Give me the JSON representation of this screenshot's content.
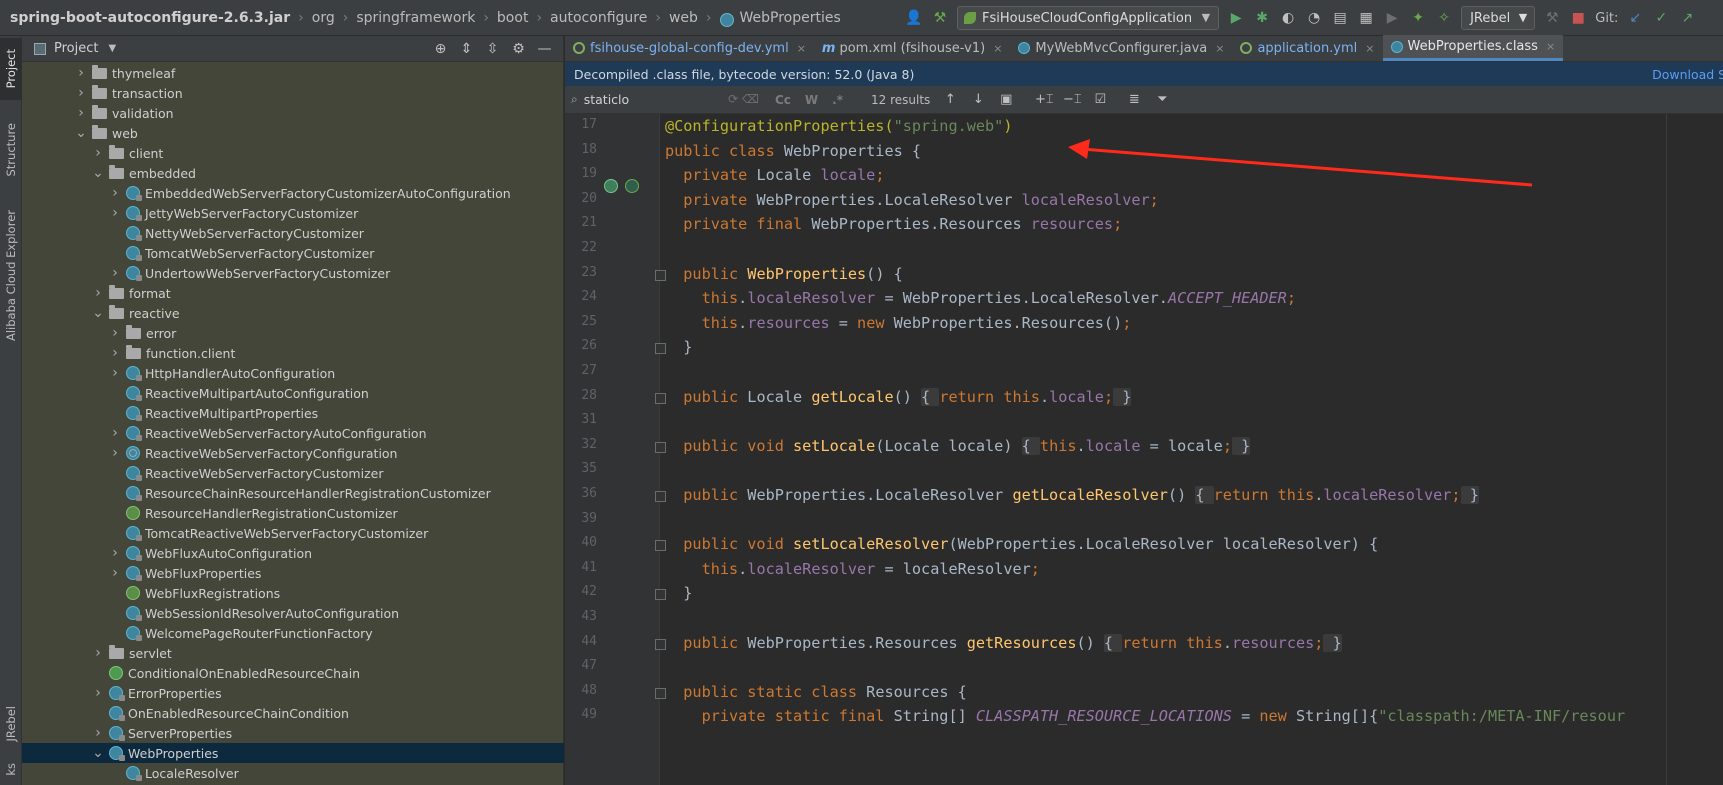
{
  "breadcrumb": {
    "items": [
      "spring-boot-autoconfigure-2.6.3.jar",
      "org",
      "springframework",
      "boot",
      "autoconfigure",
      "web"
    ],
    "current": "WebProperties"
  },
  "toolbar": {
    "run_config": "FsiHouseCloudConfigApplication",
    "jrebel": "JRebel",
    "git_label": "Git:"
  },
  "tool_strip": {
    "project": "Project",
    "structure": "Structure",
    "alibaba": "Alibaba Cloud Explorer",
    "jrebel": "JRebel",
    "bottom": "ks"
  },
  "project_panel": {
    "title": "Project",
    "tree": [
      {
        "label": "thymeleaf",
        "type": "folder",
        "level": 1,
        "arrow": "right"
      },
      {
        "label": "transaction",
        "type": "folder",
        "level": 1,
        "arrow": "right"
      },
      {
        "label": "validation",
        "type": "folder",
        "level": 1,
        "arrow": "right"
      },
      {
        "label": "web",
        "type": "folder",
        "level": 1,
        "arrow": "down"
      },
      {
        "label": "client",
        "type": "folder",
        "level": 2,
        "arrow": "right"
      },
      {
        "label": "embedded",
        "type": "folder",
        "level": 2,
        "arrow": "down"
      },
      {
        "label": "EmbeddedWebServerFactoryCustomizerAutoConfiguration",
        "type": "class",
        "level": 3,
        "arrow": "right"
      },
      {
        "label": "JettyWebServerFactoryCustomizer",
        "type": "class",
        "level": 3,
        "arrow": "right"
      },
      {
        "label": "NettyWebServerFactoryCustomizer",
        "type": "class",
        "level": 3,
        "arrow": "none"
      },
      {
        "label": "TomcatWebServerFactoryCustomizer",
        "type": "class",
        "level": 3,
        "arrow": "none"
      },
      {
        "label": "UndertowWebServerFactoryCustomizer",
        "type": "class",
        "level": 3,
        "arrow": "right"
      },
      {
        "label": "format",
        "type": "folder",
        "level": 2,
        "arrow": "right"
      },
      {
        "label": "reactive",
        "type": "folder",
        "level": 2,
        "arrow": "down"
      },
      {
        "label": "error",
        "type": "folder",
        "level": 3,
        "arrow": "right"
      },
      {
        "label": "function.client",
        "type": "folder",
        "level": 3,
        "arrow": "right"
      },
      {
        "label": "HttpHandlerAutoConfiguration",
        "type": "class",
        "level": 3,
        "arrow": "right"
      },
      {
        "label": "ReactiveMultipartAutoConfiguration",
        "type": "class",
        "level": 3,
        "arrow": "none"
      },
      {
        "label": "ReactiveMultipartProperties",
        "type": "class",
        "level": 3,
        "arrow": "none"
      },
      {
        "label": "ReactiveWebServerFactoryAutoConfiguration",
        "type": "class",
        "level": 3,
        "arrow": "right"
      },
      {
        "label": "ReactiveWebServerFactoryConfiguration",
        "type": "cfg",
        "level": 3,
        "arrow": "right"
      },
      {
        "label": "ReactiveWebServerFactoryCustomizer",
        "type": "class",
        "level": 3,
        "arrow": "none"
      },
      {
        "label": "ResourceChainResourceHandlerRegistrationCustomizer",
        "type": "class",
        "level": 3,
        "arrow": "none"
      },
      {
        "label": "ResourceHandlerRegistrationCustomizer",
        "type": "iface",
        "level": 3,
        "arrow": "none"
      },
      {
        "label": "TomcatReactiveWebServerFactoryCustomizer",
        "type": "class",
        "level": 3,
        "arrow": "none"
      },
      {
        "label": "WebFluxAutoConfiguration",
        "type": "class",
        "level": 3,
        "arrow": "right"
      },
      {
        "label": "WebFluxProperties",
        "type": "class",
        "level": 3,
        "arrow": "right"
      },
      {
        "label": "WebFluxRegistrations",
        "type": "iface",
        "level": 3,
        "arrow": "none"
      },
      {
        "label": "WebSessionIdResolverAutoConfiguration",
        "type": "class",
        "level": 3,
        "arrow": "none"
      },
      {
        "label": "WelcomePageRouterFunctionFactory",
        "type": "class",
        "level": 3,
        "arrow": "none"
      },
      {
        "label": "servlet",
        "type": "folder",
        "level": 2,
        "arrow": "right"
      },
      {
        "label": "ConditionalOnEnabledResourceChain",
        "type": "anno",
        "level": 2,
        "arrow": "none"
      },
      {
        "label": "ErrorProperties",
        "type": "class",
        "level": 2,
        "arrow": "right"
      },
      {
        "label": "OnEnabledResourceChainCondition",
        "type": "class",
        "level": 2,
        "arrow": "none"
      },
      {
        "label": "ServerProperties",
        "type": "class",
        "level": 2,
        "arrow": "right"
      },
      {
        "label": "WebProperties",
        "type": "class",
        "level": 2,
        "arrow": "down",
        "selected": true
      },
      {
        "label": "LocaleResolver",
        "type": "class",
        "level": 3,
        "arrow": "none"
      }
    ]
  },
  "editor": {
    "tabs": [
      {
        "label": "fsihouse-global-config-dev.yml",
        "icon": "yml",
        "active": false
      },
      {
        "label": "pom.xml (fsihouse-v1)",
        "icon": "mvn",
        "active": false
      },
      {
        "label": "MyWebMvcConfigurer.java",
        "icon": "java",
        "active": false
      },
      {
        "label": "application.yml",
        "icon": "yml",
        "active": false
      },
      {
        "label": "WebProperties.class",
        "icon": "java",
        "active": true
      }
    ],
    "info_text": "Decompiled .class file, bytecode version: 52.0 (Java 8)",
    "info_link": "Download Sc",
    "find": {
      "query": "staticlo",
      "results": "12 results",
      "opt_case": "Cc",
      "opt_word": "W",
      "opt_regex": ".*"
    },
    "line_numbers": [
      "17",
      "18",
      "19",
      "20",
      "21",
      "22",
      "23",
      "24",
      "25",
      "26",
      "27",
      "28",
      "31",
      "32",
      "35",
      "36",
      "39",
      "40",
      "41",
      "42",
      "43",
      "44",
      "47",
      "48",
      "49"
    ],
    "code_lines": [
      [
        {
          "t": "@ConfigurationProperties(",
          "c": "ann"
        },
        {
          "t": "\"spring.web\"",
          "c": "str"
        },
        {
          "t": ")",
          "c": "ann"
        }
      ],
      [
        {
          "t": "public class ",
          "c": "kw"
        },
        {
          "t": "WebProperties {",
          "c": ""
        }
      ],
      [
        {
          "t": "  private ",
          "c": "kw"
        },
        {
          "t": "Locale ",
          "c": ""
        },
        {
          "t": "locale",
          "c": "fld"
        },
        {
          "t": ";",
          "c": "kw"
        }
      ],
      [
        {
          "t": "  private ",
          "c": "kw"
        },
        {
          "t": "WebProperties.LocaleResolver ",
          "c": ""
        },
        {
          "t": "localeResolver",
          "c": "fld"
        },
        {
          "t": ";",
          "c": "kw"
        }
      ],
      [
        {
          "t": "  private final ",
          "c": "kw"
        },
        {
          "t": "WebProperties.Resources ",
          "c": ""
        },
        {
          "t": "resources",
          "c": "fld"
        },
        {
          "t": ";",
          "c": "kw"
        }
      ],
      [
        {
          "t": "",
          "c": ""
        }
      ],
      [
        {
          "t": "  public ",
          "c": "kw"
        },
        {
          "t": "WebProperties",
          "c": "mth"
        },
        {
          "t": "() {",
          "c": ""
        }
      ],
      [
        {
          "t": "    this",
          "c": "kw"
        },
        {
          "t": ".",
          "c": ""
        },
        {
          "t": "localeResolver",
          "c": "fld"
        },
        {
          "t": " = WebProperties.LocaleResolver.",
          "c": ""
        },
        {
          "t": "ACCEPT_HEADER",
          "c": "fldi"
        },
        {
          "t": ";",
          "c": "kw"
        }
      ],
      [
        {
          "t": "    this",
          "c": "kw"
        },
        {
          "t": ".",
          "c": ""
        },
        {
          "t": "resources",
          "c": "fld"
        },
        {
          "t": " = ",
          "c": ""
        },
        {
          "t": "new ",
          "c": "kw"
        },
        {
          "t": "WebProperties.Resources()",
          "c": ""
        },
        {
          "t": ";",
          "c": "kw"
        }
      ],
      [
        {
          "t": "  }",
          "c": ""
        }
      ],
      [
        {
          "t": "",
          "c": ""
        }
      ],
      [
        {
          "t": "  public ",
          "c": "kw"
        },
        {
          "t": "Locale ",
          "c": ""
        },
        {
          "t": "getLocale",
          "c": "mth"
        },
        {
          "t": "() ",
          "c": ""
        },
        {
          "t": "{ ",
          "c": "fsp"
        },
        {
          "t": "return this",
          "c": "kw"
        },
        {
          "t": ".",
          "c": ""
        },
        {
          "t": "locale",
          "c": "fld"
        },
        {
          "t": ";",
          "c": "kw"
        },
        {
          "t": " }",
          "c": "fsp"
        }
      ],
      [
        {
          "t": "",
          "c": ""
        }
      ],
      [
        {
          "t": "  public void ",
          "c": "kw"
        },
        {
          "t": "setLocale",
          "c": "mth"
        },
        {
          "t": "(Locale locale) ",
          "c": ""
        },
        {
          "t": "{ ",
          "c": "fsp"
        },
        {
          "t": "this",
          "c": "kw"
        },
        {
          "t": ".",
          "c": ""
        },
        {
          "t": "locale",
          "c": "fld"
        },
        {
          "t": " = locale",
          "c": ""
        },
        {
          "t": ";",
          "c": "kw"
        },
        {
          "t": " }",
          "c": "fsp"
        }
      ],
      [
        {
          "t": "",
          "c": ""
        }
      ],
      [
        {
          "t": "  public ",
          "c": "kw"
        },
        {
          "t": "WebProperties.LocaleResolver ",
          "c": ""
        },
        {
          "t": "getLocaleResolver",
          "c": "mth"
        },
        {
          "t": "() ",
          "c": ""
        },
        {
          "t": "{ ",
          "c": "fsp"
        },
        {
          "t": "return this",
          "c": "kw"
        },
        {
          "t": ".",
          "c": ""
        },
        {
          "t": "localeResolver",
          "c": "fld"
        },
        {
          "t": ";",
          "c": "kw"
        },
        {
          "t": " }",
          "c": "fsp"
        }
      ],
      [
        {
          "t": "",
          "c": ""
        }
      ],
      [
        {
          "t": "  public void ",
          "c": "kw"
        },
        {
          "t": "setLocaleResolver",
          "c": "mth"
        },
        {
          "t": "(WebProperties.LocaleResolver localeResolver) {",
          "c": ""
        }
      ],
      [
        {
          "t": "    this",
          "c": "kw"
        },
        {
          "t": ".",
          "c": ""
        },
        {
          "t": "localeResolver",
          "c": "fld"
        },
        {
          "t": " = localeResolver",
          "c": ""
        },
        {
          "t": ";",
          "c": "kw"
        }
      ],
      [
        {
          "t": "  }",
          "c": ""
        }
      ],
      [
        {
          "t": "",
          "c": ""
        }
      ],
      [
        {
          "t": "  public ",
          "c": "kw"
        },
        {
          "t": "WebProperties.Resources ",
          "c": ""
        },
        {
          "t": "getResources",
          "c": "mth"
        },
        {
          "t": "() ",
          "c": ""
        },
        {
          "t": "{ ",
          "c": "fsp"
        },
        {
          "t": "return this",
          "c": "kw"
        },
        {
          "t": ".",
          "c": ""
        },
        {
          "t": "resources",
          "c": "fld"
        },
        {
          "t": ";",
          "c": "kw"
        },
        {
          "t": " }",
          "c": "fsp"
        }
      ],
      [
        {
          "t": "",
          "c": ""
        }
      ],
      [
        {
          "t": "  public static class ",
          "c": "kw"
        },
        {
          "t": "Resources {",
          "c": ""
        }
      ],
      [
        {
          "t": "    private static final ",
          "c": "kw"
        },
        {
          "t": "String[] ",
          "c": ""
        },
        {
          "t": "CLASSPATH_RESOURCE_LOCATIONS",
          "c": "fldi"
        },
        {
          "t": " = ",
          "c": ""
        },
        {
          "t": "new ",
          "c": "kw"
        },
        {
          "t": "String[]{",
          "c": ""
        },
        {
          "t": "\"classpath:/META-INF/resour",
          "c": "str"
        }
      ]
    ]
  },
  "annotation_color": "#ff2a1a"
}
